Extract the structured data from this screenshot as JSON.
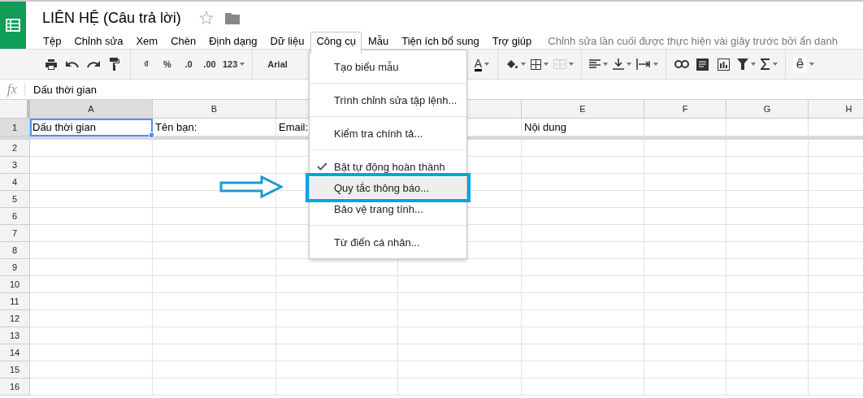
{
  "document": {
    "title": "LIÊN HỆ (Câu trả lời)",
    "starred": false
  },
  "menu_bar": [
    {
      "label": "Tệp",
      "selected": false
    },
    {
      "label": "Chỉnh sửa",
      "selected": false
    },
    {
      "label": "Xem",
      "selected": false
    },
    {
      "label": "Chèn",
      "selected": false
    },
    {
      "label": "Định dạng",
      "selected": false
    },
    {
      "label": "Dữ liệu",
      "selected": false
    },
    {
      "label": "Công cụ",
      "selected": true
    },
    {
      "label": "Mẫu",
      "selected": false
    },
    {
      "label": "Tiện ích bổ sung",
      "selected": false
    },
    {
      "label": "Trợ giúp",
      "selected": false
    }
  ],
  "last_edit": "Chỉnh sửa lần cuối được thực hiện vài giây trước bởi ẩn danh",
  "toolbar_left": [
    {
      "kind": "print"
    },
    {
      "kind": "undo"
    },
    {
      "kind": "redo"
    },
    {
      "kind": "paint-format"
    },
    {
      "kind": "separator"
    },
    {
      "kind": "text",
      "label": "₫"
    },
    {
      "kind": "text",
      "label": "%"
    },
    {
      "kind": "text",
      "label": ".0"
    },
    {
      "kind": "text",
      "label": ".00"
    },
    {
      "kind": "text",
      "label": "123",
      "dropdown": true
    },
    {
      "kind": "separator"
    },
    {
      "kind": "font",
      "label": "Arial"
    }
  ],
  "toolbar_right": [
    {
      "kind": "text-color",
      "label": "A",
      "dropdown": true
    },
    {
      "kind": "separator"
    },
    {
      "kind": "fill",
      "dropdown": true
    },
    {
      "kind": "borders",
      "dropdown": true
    },
    {
      "kind": "merge",
      "dropdown": true,
      "disabled": true
    },
    {
      "kind": "separator"
    },
    {
      "kind": "align",
      "dropdown": true
    },
    {
      "kind": "valign",
      "dropdown": true
    },
    {
      "kind": "wrap",
      "dropdown": true
    },
    {
      "kind": "separator"
    },
    {
      "kind": "link"
    },
    {
      "kind": "comment"
    },
    {
      "kind": "chart"
    },
    {
      "kind": "filter",
      "dropdown": true
    },
    {
      "kind": "sum",
      "dropdown": true
    },
    {
      "kind": "separator"
    },
    {
      "kind": "text",
      "label": "ê",
      "dropdown": true
    }
  ],
  "formula_bar": {
    "fx": "fx",
    "value": "Dấu thời gian"
  },
  "columns": [
    "A",
    "B",
    null,
    null,
    "E",
    "F",
    "G",
    "H"
  ],
  "rows": [
    {
      "number": "1",
      "cells": [
        {
          "text": "Dấu thời gian",
          "selected": true
        },
        {
          "text": "Tên bạn:",
          "selected": false
        },
        {
          "text": "Email:",
          "selected": false
        },
        {
          "selected": false
        },
        {
          "text": "Nội dung",
          "selected": false
        },
        {
          "selected": false
        },
        {
          "selected": false
        },
        {
          "selected": false
        }
      ]
    },
    {
      "number": "2"
    },
    {
      "number": "3"
    },
    {
      "number": "4"
    },
    {
      "number": "5"
    },
    {
      "number": "6"
    },
    {
      "number": "7"
    },
    {
      "number": "8"
    },
    {
      "number": "9"
    },
    {
      "number": "10"
    },
    {
      "number": "11"
    },
    {
      "number": "12"
    },
    {
      "number": "13"
    },
    {
      "number": "14"
    },
    {
      "number": "15"
    },
    {
      "number": "16"
    }
  ],
  "tools_menu": [
    [
      {
        "label": "Tạo biểu mẫu",
        "checked": false,
        "selected": false
      }
    ],
    [
      {
        "label": "Trình chỉnh sửa tập lệnh...",
        "checked": false,
        "selected": false
      }
    ],
    [
      {
        "label": "Kiểm tra chính tả...",
        "checked": false,
        "selected": false
      }
    ],
    [
      {
        "label": "Bật tự động hoàn thành",
        "checked": true,
        "selected": false
      },
      {
        "label": "Quy tắc thông báo...",
        "checked": false,
        "selected": true
      },
      {
        "label": "Bảo vệ trang tính...",
        "checked": false,
        "selected": false
      }
    ],
    [
      {
        "label": "Từ điển cá nhân...",
        "checked": false,
        "selected": false
      }
    ]
  ]
}
